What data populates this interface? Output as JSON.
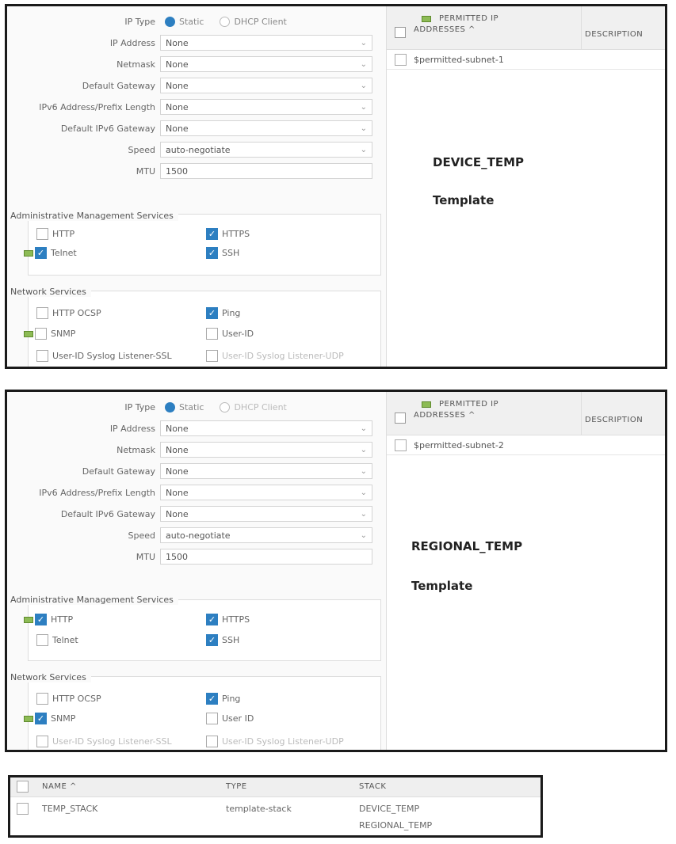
{
  "panels": [
    {
      "ip_type_label": "IP Type",
      "ip_type_options": [
        "Static",
        "DHCP Client"
      ],
      "fields": [
        {
          "label": "IP Address",
          "value": "None"
        },
        {
          "label": "Netmask",
          "value": "None"
        },
        {
          "label": "Default Gateway",
          "value": "None"
        },
        {
          "label": "IPv6 Address/Prefix Length",
          "value": "None"
        },
        {
          "label": "Default IPv6 Gateway",
          "value": "None"
        },
        {
          "label": "Speed",
          "value": "auto-negotiate"
        }
      ],
      "mtu_label": "MTU",
      "mtu_value": "1500",
      "admin_title": "Administrative Management Services",
      "admin": [
        {
          "label": "HTTP",
          "checked": false
        },
        {
          "label": "HTTPS",
          "checked": true
        },
        {
          "label": "Telnet",
          "checked": true
        },
        {
          "label": "SSH",
          "checked": true
        }
      ],
      "net_title": "Network Services",
      "net": [
        {
          "label": "HTTP OCSP",
          "checked": false
        },
        {
          "label": "Ping",
          "checked": true
        },
        {
          "label": "SNMP",
          "checked": false
        },
        {
          "label": "User-ID",
          "checked": false
        },
        {
          "label": "User-ID Syslog Listener-SSL",
          "checked": false
        },
        {
          "label": "User-ID Syslog Listener-UDP",
          "checked": false
        }
      ],
      "table_head": {
        "col1_line1": "PERMITTED IP",
        "col1_line2": "ADDRESSES ^",
        "col2": "DESCRIPTION"
      },
      "table_row": "$permitted-subnet-1",
      "overlay_title": "DEVICE_TEMP",
      "overlay_sub": "Template"
    },
    {
      "ip_type_label": "IP Type",
      "ip_type_options": [
        "Static",
        "DHCP Client"
      ],
      "fields": [
        {
          "label": "IP Address",
          "value": "None"
        },
        {
          "label": "Netmask",
          "value": "None"
        },
        {
          "label": "Default Gateway",
          "value": "None"
        },
        {
          "label": "IPv6 Address/Prefix Length",
          "value": "None"
        },
        {
          "label": "Default IPv6 Gateway",
          "value": "None"
        },
        {
          "label": "Speed",
          "value": "auto-negotiate"
        }
      ],
      "mtu_label": "MTU",
      "mtu_value": "1500",
      "admin_title": "Administrative Management Services",
      "admin": [
        {
          "label": "HTTP",
          "checked": true
        },
        {
          "label": "HTTPS",
          "checked": true
        },
        {
          "label": "Telnet",
          "checked": false
        },
        {
          "label": "SSH",
          "checked": true
        }
      ],
      "net_title": "Network Services",
      "net": [
        {
          "label": "HTTP OCSP",
          "checked": false
        },
        {
          "label": "Ping",
          "checked": true
        },
        {
          "label": "SNMP",
          "checked": true
        },
        {
          "label": "User ID",
          "checked": false
        },
        {
          "label": "User-ID Syslog Listener-SSL",
          "checked": false
        },
        {
          "label": "User-ID Syslog Listener-UDP",
          "checked": false
        }
      ],
      "table_head": {
        "col1_line1": "PERMITTED IP",
        "col1_line2": "ADDRESSES ^",
        "col2": "DESCRIPTION"
      },
      "table_row": "$permitted-subnet-2",
      "overlay_title": "REGIONAL_TEMP",
      "overlay_sub": "Template"
    }
  ],
  "stack_table": {
    "headers": [
      "NAME ^",
      "TYPE",
      "STACK"
    ],
    "name": "TEMP_STACK",
    "type": "template-stack",
    "stack": [
      "DEVICE_TEMP",
      "REGIONAL_TEMP"
    ]
  },
  "colors": {
    "accent": "#2d7fc1",
    "tag_green": "#8dbb55"
  }
}
